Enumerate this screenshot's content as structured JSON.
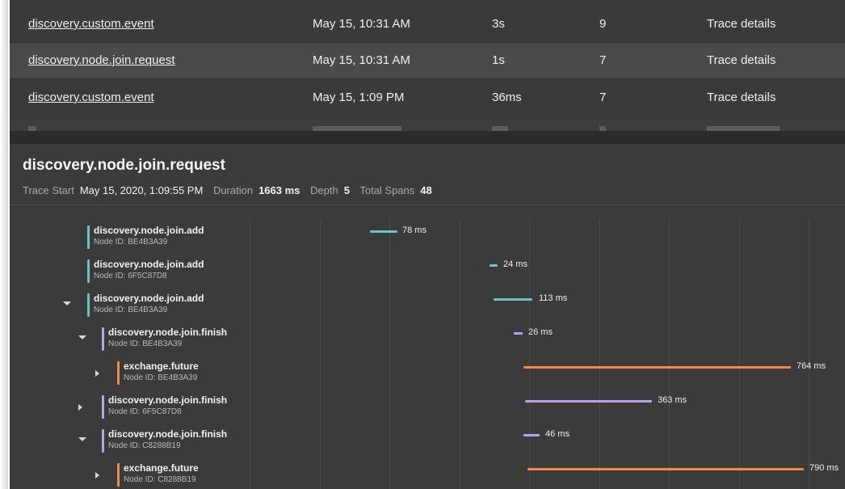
{
  "colors": {
    "teal": "#6ac4c4",
    "lavender": "#b7a3e6",
    "orange": "#f0894a",
    "background": "#3a3a3a"
  },
  "trace_list": {
    "rows": [
      {
        "name": "discovery.custom.event",
        "date": "May 15, 10:31 AM",
        "duration": "3s",
        "depth": "9",
        "details": "Trace details"
      },
      {
        "name": "discovery.node.join.request",
        "date": "May 15, 10:31 AM",
        "duration": "1s",
        "depth": "7",
        "details": "Trace details"
      },
      {
        "name": "discovery.custom.event",
        "date": "May 15, 1:09 PM",
        "duration": "36ms",
        "depth": "7",
        "details": "Trace details"
      }
    ]
  },
  "detail": {
    "title": "discovery.node.join.request",
    "trace_start_label": "Trace Start",
    "trace_start": "May 15, 2020, 1:09:55 PM",
    "duration_label": "Duration",
    "duration": "1663 ms",
    "depth_label": "Depth",
    "depth": "5",
    "total_spans_label": "Total Spans",
    "total_spans": "48"
  },
  "spans": [
    {
      "name": "discovery.node.join.add",
      "node": "Node ID: BE4B3A39",
      "duration": "78 ms",
      "color": "teal",
      "toggle": "none"
    },
    {
      "name": "discovery.node.join.add",
      "node": "Node ID: 6F5C87D8",
      "duration": "24 ms",
      "color": "teal",
      "toggle": "none"
    },
    {
      "name": "discovery.node.join.add",
      "node": "Node ID: BE4B3A39",
      "duration": "113 ms",
      "color": "teal",
      "toggle": "expanded"
    },
    {
      "name": "discovery.node.join.finish",
      "node": "Node ID: BE4B3A39",
      "duration": "26 ms",
      "color": "lavender",
      "toggle": "expanded"
    },
    {
      "name": "exchange.future",
      "node": "Node ID: BE4B3A39",
      "duration": "764 ms",
      "color": "orange",
      "toggle": "collapsed"
    },
    {
      "name": "discovery.node.join.finish",
      "node": "Node ID: 6F5C87D8",
      "duration": "363 ms",
      "color": "lavender",
      "toggle": "collapsed"
    },
    {
      "name": "discovery.node.join.finish",
      "node": "Node ID: C8288B19",
      "duration": "46 ms",
      "color": "lavender",
      "toggle": "expanded"
    },
    {
      "name": "exchange.future",
      "node": "Node ID: C8288B19",
      "duration": "790 ms",
      "color": "orange",
      "toggle": "collapsed"
    }
  ]
}
